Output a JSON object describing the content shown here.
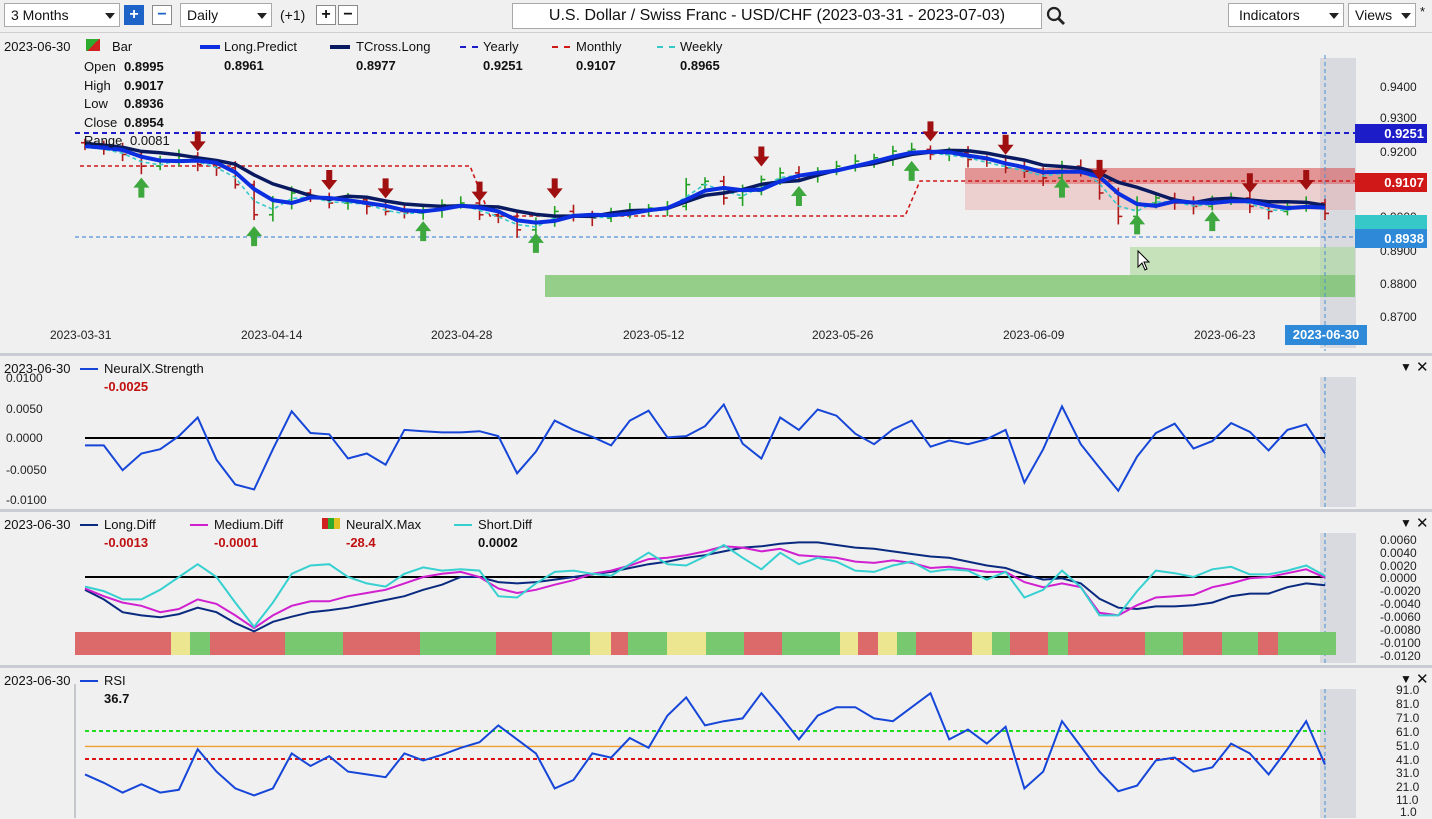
{
  "toolbar": {
    "period": "3 Months",
    "interval": "Daily",
    "offset": "(+1)",
    "title": "U.S. Dollar / Swiss Franc - USD/CHF (2023-03-31 - 2023-07-03)",
    "indicators": "Indicators",
    "views": "Views"
  },
  "main": {
    "date": "2023-06-30",
    "legend": [
      {
        "name": "Bar",
        "value": ""
      },
      {
        "name": "Long.Predict",
        "value": "0.8961"
      },
      {
        "name": "TCross.Long",
        "value": "0.8977"
      },
      {
        "name": "Yearly",
        "value": "0.9251"
      },
      {
        "name": "Monthly",
        "value": "0.9107"
      },
      {
        "name": "Weekly",
        "value": "0.8965"
      }
    ],
    "ohlc": [
      {
        "k": "Open",
        "v": "0.8995"
      },
      {
        "k": "High",
        "v": "0.9017"
      },
      {
        "k": "Low",
        "v": "0.8936"
      },
      {
        "k": "Close",
        "v": "0.8954"
      },
      {
        "k": "Range",
        "v": "0.0081"
      }
    ],
    "y_ticks": [
      "0.9400",
      "0.9300",
      "0.9200",
      "0.9000",
      "0.8900",
      "0.8800",
      "0.8700"
    ],
    "x_ticks": [
      "2023-03-31",
      "2023-04-14",
      "2023-04-28",
      "2023-05-12",
      "2023-05-26",
      "2023-06-09",
      "2023-06-23"
    ],
    "current_date_tag": "2023-06-30",
    "price_tags": {
      "yearly": "0.9251",
      "monthly": "0.9107",
      "last": "0.8938"
    },
    "colors": {
      "yearly": "#1c1cc8",
      "monthly": "#d01818",
      "weekly": "#36c8c8",
      "long_predict": "#0a2ee0",
      "tcross": "#0a1a60"
    }
  },
  "strength": {
    "date": "2023-06-30",
    "name": "NeuralX.Strength",
    "value": "-0.0025",
    "y_ticks": [
      "0.0100",
      "0.0050",
      "0.0000",
      "-0.0050",
      "-0.0100"
    ]
  },
  "diff": {
    "date": "2023-06-30",
    "legend": [
      {
        "name": "Long.Diff",
        "value": "-0.0013"
      },
      {
        "name": "Medium.Diff",
        "value": "-0.0001"
      },
      {
        "name": "NeuralX.Max",
        "value": "-28.4"
      },
      {
        "name": "Short.Diff",
        "value": "0.0002"
      }
    ],
    "y_ticks": [
      "0.0060",
      "0.0040",
      "0.0020",
      "0.0000",
      "-0.0020",
      "-0.0040",
      "-0.0060",
      "-0.0080",
      "-0.0100",
      "-0.0120"
    ]
  },
  "rsi": {
    "date": "2023-06-30",
    "name": "RSI",
    "value": "36.7",
    "y_ticks": [
      "91.0",
      "81.0",
      "71.0",
      "61.0",
      "51.0",
      "41.0",
      "31.0",
      "21.0",
      "11.0",
      "1.0"
    ]
  },
  "chart_data": [
    {
      "type": "line",
      "title": "NeuralX.Strength",
      "ylim": [
        -0.01,
        0.01
      ],
      "series": [
        {
          "name": "NeuralX.Strength",
          "values": [
            -0.0012,
            -0.0012,
            -0.0052,
            -0.0025,
            -0.0018,
            0.0003,
            0.0033,
            -0.0035,
            -0.0075,
            -0.0083,
            -0.0018,
            0.0043,
            0.0008,
            0.0006,
            -0.0033,
            -0.0025,
            -0.0043,
            0.0013,
            0.0011,
            0.0009,
            0.0009,
            0.0011,
            0.0003,
            -0.0057,
            -0.0022,
            0.0028,
            0.0013,
            0.0002,
            -0.0012,
            0.0028,
            0.0044,
            0.0001,
            0.0003,
            0.0019,
            0.0054,
            -0.0009,
            -0.0033,
            0.0033,
            0.0013,
            0.0046,
            0.0036,
            0.0007,
            -0.001,
            0.0014,
            0.0028,
            -0.0014,
            -0.0004,
            -0.001,
            -0.0002,
            0.0013,
            -0.0072,
            -0.0018,
            0.0051,
            -0.001,
            -0.0048,
            -0.0085,
            -0.003,
            0.0008,
            0.0023,
            -0.0017,
            -0.0005,
            0.0024,
            0.001,
            -0.002,
            0.0013,
            0.0022,
            -0.0025
          ]
        }
      ]
    },
    {
      "type": "line",
      "title": "Diff",
      "ylim": [
        -0.012,
        0.006
      ],
      "series": [
        {
          "name": "Long.Diff",
          "values": [
            -0.002,
            -0.0035,
            -0.0055,
            -0.006,
            -0.0063,
            -0.0058,
            -0.0048,
            -0.0055,
            -0.0072,
            -0.0085,
            -0.007,
            -0.0062,
            -0.0055,
            -0.0052,
            -0.0048,
            -0.0042,
            -0.0036,
            -0.003,
            -0.002,
            -0.0012,
            0.0,
            0.0,
            -0.0008,
            -0.001,
            -0.0008,
            -0.0004,
            0.0,
            0.0004,
            0.0008,
            0.0014,
            0.002,
            0.0024,
            0.003,
            0.0034,
            0.004,
            0.0046,
            0.0048,
            0.0052,
            0.0054,
            0.0054,
            0.005,
            0.0046,
            0.0044,
            0.004,
            0.0036,
            0.0032,
            0.003,
            0.0024,
            0.0018,
            0.0014,
            0.0004,
            -0.0004,
            -0.0002,
            -0.001,
            -0.0034,
            -0.0048,
            -0.005,
            -0.0046,
            -0.0046,
            -0.0044,
            -0.004,
            -0.003,
            -0.0026,
            -0.0026,
            -0.0016,
            -0.001,
            -0.0013
          ]
        },
        {
          "name": "Medium.Diff",
          "values": [
            -0.0018,
            -0.003,
            -0.004,
            -0.0045,
            -0.0055,
            -0.005,
            -0.0035,
            -0.0042,
            -0.006,
            -0.008,
            -0.006,
            -0.0045,
            -0.0038,
            -0.0038,
            -0.003,
            -0.0025,
            -0.002,
            -0.001,
            0.0,
            0.0005,
            0.0008,
            0.0,
            -0.0018,
            -0.0025,
            -0.002,
            -0.0012,
            -0.0005,
            0.0005,
            0.001,
            0.0018,
            0.0028,
            0.003,
            0.0034,
            0.004,
            0.0048,
            0.0046,
            0.004,
            0.0044,
            0.0034,
            0.0032,
            0.003,
            0.0024,
            0.0022,
            0.0026,
            0.0022,
            0.0014,
            0.0016,
            0.0012,
            0.0008,
            0.0008,
            -0.0008,
            -0.0016,
            -0.001,
            -0.0016,
            -0.0056,
            -0.006,
            -0.0044,
            -0.0032,
            -0.003,
            -0.0028,
            -0.0016,
            -0.001,
            -0.0002,
            0.0,
            0.0006,
            0.0012,
            -0.0001
          ]
        },
        {
          "name": "Short.Diff",
          "values": [
            -0.0015,
            -0.0022,
            -0.0035,
            -0.0035,
            -0.002,
            0.0,
            0.002,
            0.0,
            -0.004,
            -0.0078,
            -0.004,
            0.0005,
            0.0018,
            0.002,
            0.0,
            -0.001,
            -0.0015,
            0.0005,
            0.0015,
            0.001,
            0.0012,
            0.001,
            -0.003,
            -0.0032,
            -0.001,
            0.0008,
            0.001,
            0.0005,
            0.0002,
            0.002,
            0.0038,
            0.002,
            0.0018,
            0.0032,
            0.005,
            0.003,
            0.0012,
            0.0038,
            0.002,
            0.003,
            0.0024,
            0.001,
            0.0008,
            0.0018,
            0.0024,
            0.0008,
            0.0012,
            0.001,
            -0.0004,
            0.0008,
            -0.0032,
            -0.002,
            0.001,
            -0.0016,
            -0.006,
            -0.006,
            -0.0022,
            0.001,
            0.0006,
            0.0,
            0.0012,
            0.0016,
            0.0004,
            0.0004,
            0.001,
            0.0018,
            0.0002
          ]
        }
      ]
    },
    {
      "type": "line",
      "title": "RSI",
      "ylim": [
        1,
        91
      ],
      "series": [
        {
          "name": "RSI",
          "values": [
            30,
            24,
            17,
            23,
            17,
            19,
            48,
            32,
            20,
            15,
            20,
            45,
            36,
            43,
            32,
            30,
            28,
            45,
            40,
            44,
            49,
            53,
            65,
            55,
            45,
            20,
            26,
            45,
            42,
            56,
            49,
            72,
            85,
            65,
            68,
            70,
            88,
            72,
            55,
            72,
            78,
            78,
            70,
            68,
            78,
            88,
            55,
            62,
            52,
            64,
            20,
            32,
            68,
            50,
            32,
            18,
            22,
            40,
            42,
            32,
            35,
            52,
            45,
            30,
            48,
            68,
            37
          ]
        }
      ]
    }
  ]
}
